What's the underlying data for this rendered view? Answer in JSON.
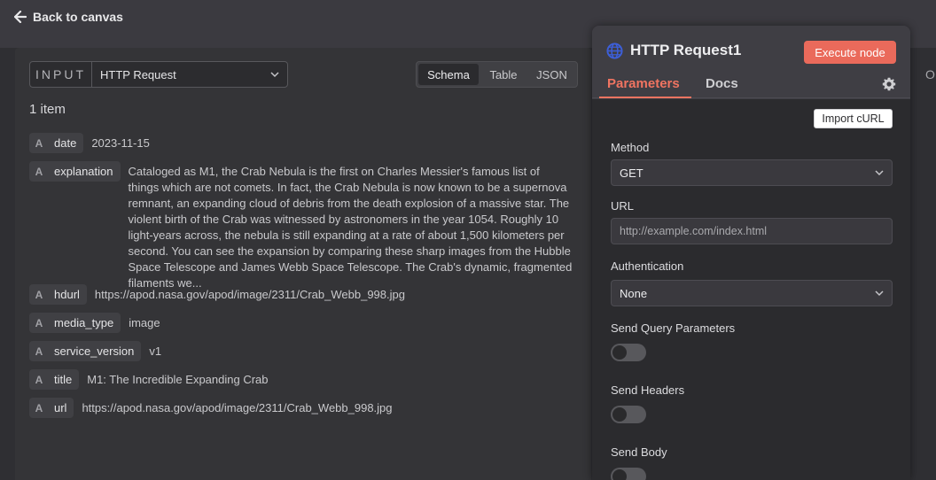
{
  "topbar": {
    "back_label": "Back to canvas"
  },
  "input_panel": {
    "tag": "INPUT",
    "selected_node": "HTTP Request",
    "view_tabs": [
      "Schema",
      "Table",
      "JSON"
    ],
    "active_view": "Schema",
    "item_count": "1 item",
    "fields": [
      {
        "type": "A",
        "key": "date",
        "value": "2023-11-15"
      },
      {
        "type": "A",
        "key": "explanation",
        "value": "Cataloged as M1, the Crab Nebula is the first on Charles Messier's famous list of things which are not comets. In fact, the Crab Nebula is now known to be a supernova remnant, an expanding cloud of debris from the death explosion of a massive star. The violent birth of the Crab was witnessed by astronomers in the year 1054. Roughly 10 light-years across, the nebula is still expanding at a rate of about 1,500 kilometers per second. You can see the expansion by comparing these sharp images from the Hubble Space Telescope and James Webb Space Telescope. The Crab's dynamic, fragmented filaments we..."
      },
      {
        "type": "A",
        "key": "hdurl",
        "value": "https://apod.nasa.gov/apod/image/2311/Crab_Webb_998.jpg"
      },
      {
        "type": "A",
        "key": "media_type",
        "value": "image"
      },
      {
        "type": "A",
        "key": "service_version",
        "value": "v1"
      },
      {
        "type": "A",
        "key": "title",
        "value": "M1: The Incredible Expanding Crab"
      },
      {
        "type": "A",
        "key": "url",
        "value": "https://apod.nasa.gov/apod/image/2311/Crab_Webb_998.jpg"
      }
    ]
  },
  "node_panel": {
    "title": "HTTP Request1",
    "execute_label": "Execute node",
    "tabs": [
      "Parameters",
      "Docs"
    ],
    "active_tab": "Parameters",
    "import_curl_label": "Import cURL",
    "method": {
      "label": "Method",
      "value": "GET"
    },
    "url": {
      "label": "URL",
      "placeholder": "http://example.com/index.html"
    },
    "authentication": {
      "label": "Authentication",
      "value": "None"
    },
    "send_query": {
      "label": "Send Query Parameters",
      "enabled": false
    },
    "send_headers": {
      "label": "Send Headers",
      "enabled": false
    },
    "send_body": {
      "label": "Send Body",
      "enabled": false
    }
  },
  "edge_text": "O",
  "colors": {
    "accent": "#ea6a5b",
    "tab_active": "#f07461",
    "globe": "#3d5fd9"
  }
}
